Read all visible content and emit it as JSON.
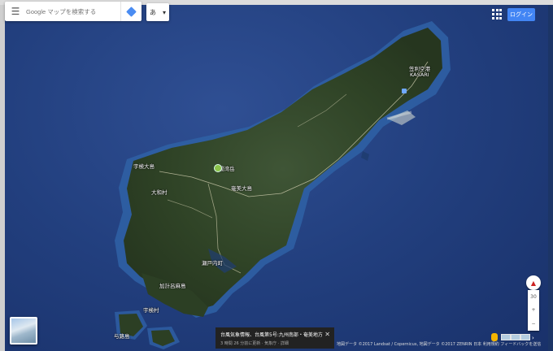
{
  "search": {
    "placeholder": "Google マップを検索する"
  },
  "menu_icon": "menu-icon",
  "language": {
    "label": "あ",
    "arrow": "▾"
  },
  "header": {
    "login_label": "ログイン"
  },
  "map_labels": {
    "kasari": "笠利空港",
    "kasari_en": "KASARI",
    "amami_oshima": "奄美大島",
    "yuwandake": "湯湾岳",
    "uken": "宇検村",
    "setouchi": "瀬戸内町",
    "kakeroma": "加計呂麻島",
    "uke": "与路島",
    "northwest": "宇検大島",
    "yamato": "大和村"
  },
  "notification": {
    "title": "台風気象情報、台風第5号:九州南部・奄美地方",
    "subtitle": "3 時間 26 分前に更新 · 気象庁 · 詳細",
    "close": "✕"
  },
  "attribution": "地図データ ©2017 Landsat / Copernicus, 地図データ ©2017 ZENRIN   日本   利用規約   フィードバックを送信",
  "controls": {
    "compass": "▲",
    "zoom_level": "30",
    "zoom_in": "+",
    "zoom_out": "−"
  },
  "colors": {
    "ocean": "#223f7e",
    "land": "#3b4a2e",
    "accent": "#4285f4"
  }
}
